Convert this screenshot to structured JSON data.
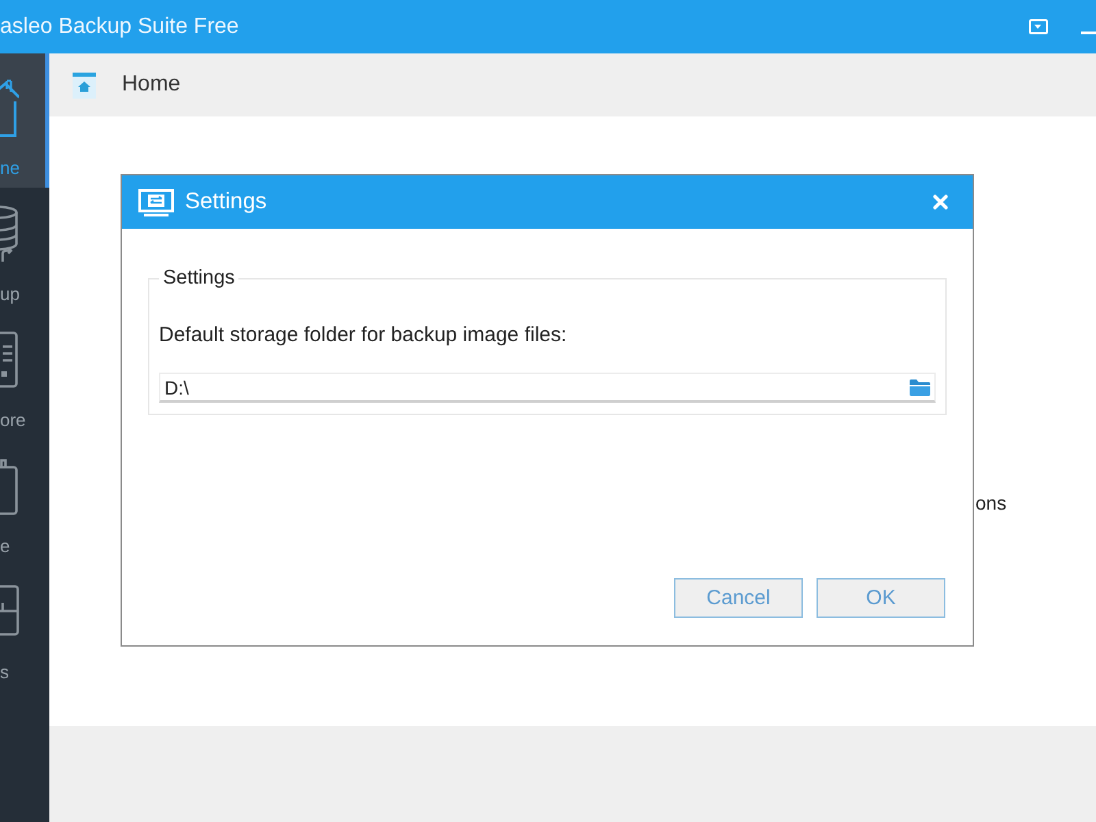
{
  "window": {
    "title": "asleo Backup Suite Free"
  },
  "sidebar": {
    "items": [
      {
        "label": "ne",
        "selected": true
      },
      {
        "label": "up",
        "selected": false
      },
      {
        "label": "ore",
        "selected": false
      },
      {
        "label": "e",
        "selected": false
      },
      {
        "label": "s",
        "selected": false
      }
    ]
  },
  "header": {
    "title": "Home"
  },
  "content": {
    "partial_text": "ons"
  },
  "dialog": {
    "title": "Settings",
    "group": {
      "legend": "Settings",
      "label": "Default storage folder for backup image files:",
      "folder": {
        "value": "D:\\"
      }
    },
    "buttons": [
      {
        "label": "Cancel"
      },
      {
        "label": "OK"
      }
    ]
  }
}
